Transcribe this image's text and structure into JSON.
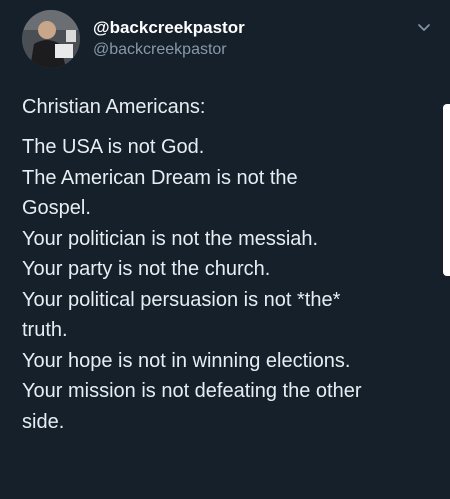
{
  "author": {
    "display_name": "@backcreekpastor",
    "handle": "@backcreekpastor"
  },
  "tweet": {
    "heading": "Christian Americans:",
    "lines": [
      "The USA is not God.",
      "The American Dream is not the",
      "Gospel.",
      "Your politician is not the messiah.",
      "Your party is not the church.",
      "Your political persuasion is not *the*",
      "truth.",
      "Your hope is not in winning elections.",
      "Your mission is not defeating the other",
      "side."
    ]
  },
  "icons": {
    "avatar": "profile-photo",
    "menu": "chevron-down-icon"
  },
  "colors": {
    "background": "#15202b",
    "text": "#e7edf2",
    "secondary_text": "#8899a6"
  }
}
